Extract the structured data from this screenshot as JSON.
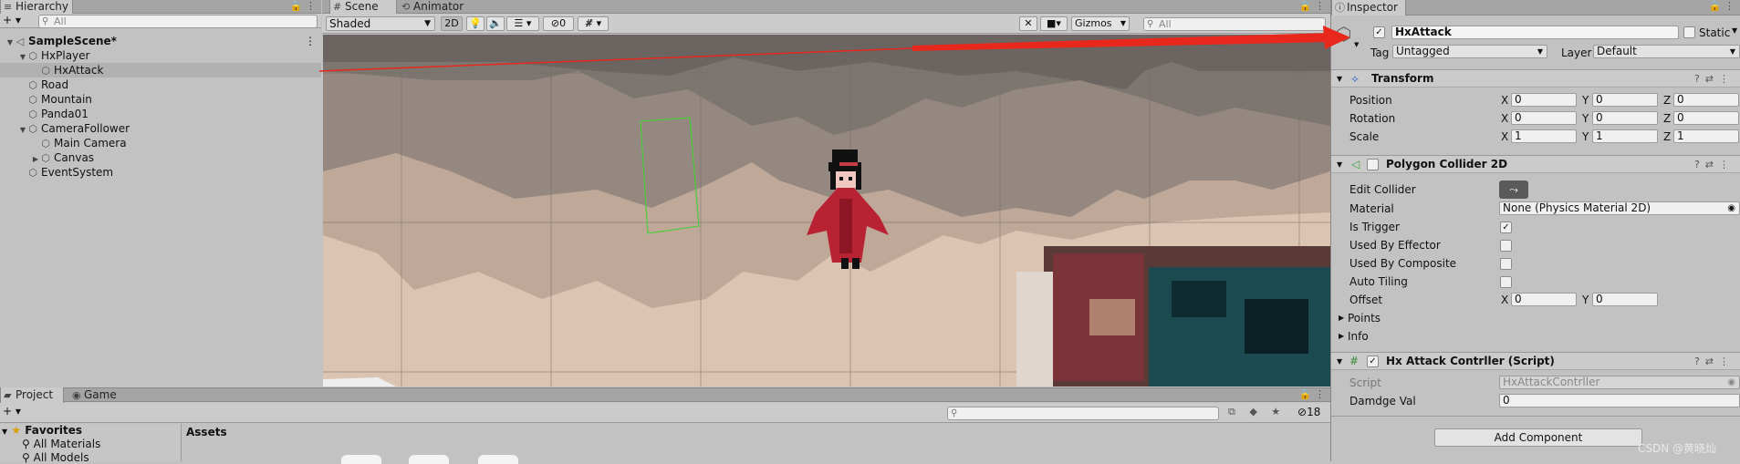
{
  "hierarchy": {
    "tab": "Hierarchy",
    "add": "+ ▾",
    "search_placeholder": "All",
    "items": [
      {
        "label": "SampleScene*",
        "depth": 0,
        "expand": "▼",
        "icon": "◁",
        "bold": true
      },
      {
        "label": "HxPlayer",
        "depth": 1,
        "expand": "▼",
        "icon": "⬡"
      },
      {
        "label": "HxAttack",
        "depth": 2,
        "expand": "",
        "icon": "⬡",
        "selected": true
      },
      {
        "label": "Road",
        "depth": 1,
        "expand": "",
        "icon": "⬡"
      },
      {
        "label": "Mountain",
        "depth": 1,
        "expand": "",
        "icon": "⬡"
      },
      {
        "label": "Panda01",
        "depth": 1,
        "expand": "",
        "icon": "⬡"
      },
      {
        "label": "CameraFollower",
        "depth": 1,
        "expand": "▼",
        "icon": "⬡"
      },
      {
        "label": "Main Camera",
        "depth": 2,
        "expand": "",
        "icon": "⬡"
      },
      {
        "label": "Canvas",
        "depth": 2,
        "expand": "▶",
        "icon": "⬡"
      },
      {
        "label": "EventSystem",
        "depth": 1,
        "expand": "",
        "icon": "⬡"
      }
    ]
  },
  "scene": {
    "tabs": [
      "Scene",
      "Animator"
    ],
    "shading": "Shaded",
    "mode_2d": "2D",
    "fx_hidden": "0",
    "gizmos": "Gizmos",
    "search_placeholder": "All"
  },
  "project": {
    "tabs": [
      "Project",
      "Game"
    ],
    "favorites": "Favorites",
    "fav_items": [
      "All Materials",
      "All Models"
    ],
    "assets": "Assets",
    "hidden_count": "18",
    "add": "+ ▾"
  },
  "inspector": {
    "tab": "Inspector",
    "object_name": "HxAttack",
    "static_label": "Static",
    "tag_label": "Tag",
    "tag_value": "Untagged",
    "layer_label": "Layer",
    "layer_value": "Default",
    "transform": {
      "title": "Transform",
      "position": {
        "label": "Position",
        "x": "0",
        "y": "0",
        "z": "0"
      },
      "rotation": {
        "label": "Rotation",
        "x": "0",
        "y": "0",
        "z": "0"
      },
      "scale": {
        "label": "Scale",
        "x": "1",
        "y": "1",
        "z": "1"
      }
    },
    "collider": {
      "title": "Polygon Collider 2D",
      "edit_collider": "Edit Collider",
      "material_label": "Material",
      "material_value": "None (Physics Material 2D)",
      "is_trigger": "Is Trigger",
      "used_by_effector": "Used By Effector",
      "used_by_composite": "Used By Composite",
      "auto_tiling": "Auto Tiling",
      "offset_label": "Offset",
      "offset_x": "0",
      "offset_y": "0",
      "points": "Points",
      "info": "Info"
    },
    "script": {
      "title": "Hx Attack Contrller (Script)",
      "script_label": "Script",
      "script_value": "HxAttackContrller",
      "damage_label": "Damdge Val",
      "damage_value": "0"
    },
    "add_component": "Add Component"
  },
  "watermark": "CSDN @黄晓灿",
  "axes": {
    "x": "X",
    "y": "Y",
    "z": "Z"
  },
  "colors": {
    "arrow": "#e8281c",
    "collider": "#4ccc3a",
    "panel": "#c2c2c2",
    "toolbar": "#cbcbcb"
  }
}
